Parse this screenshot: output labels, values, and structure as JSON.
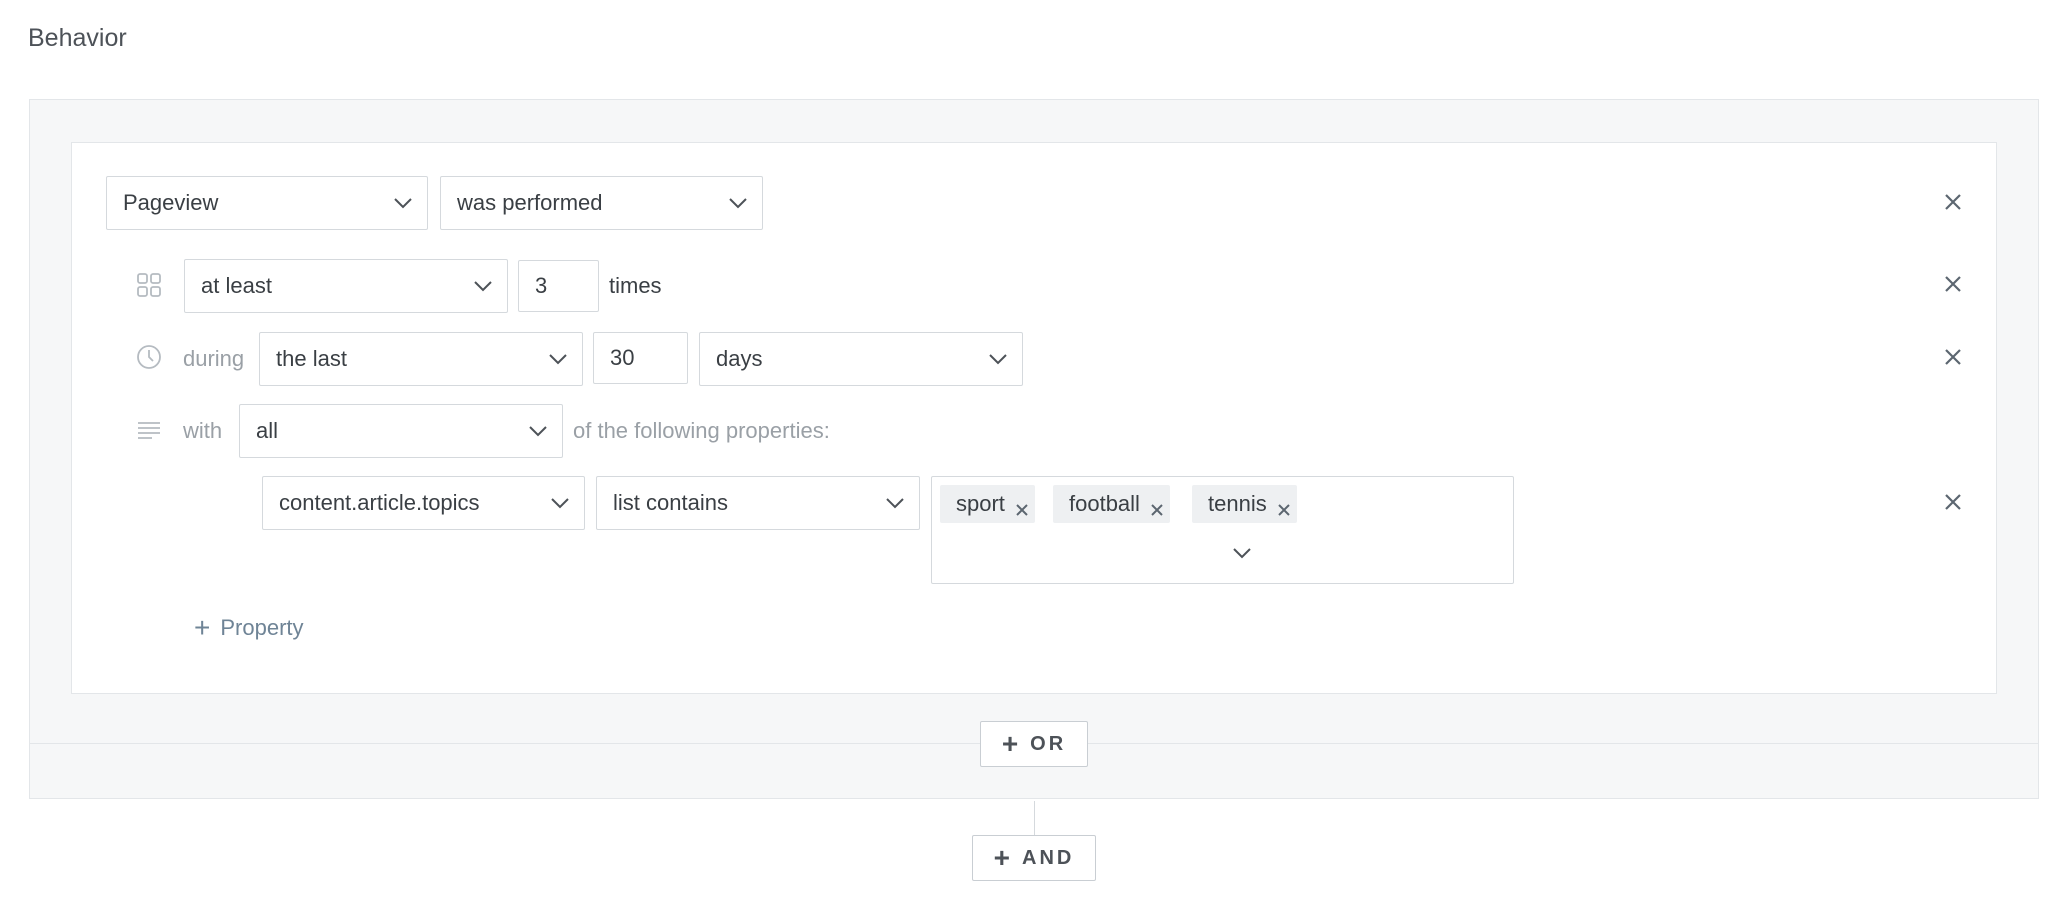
{
  "section": {
    "title": "Behavior"
  },
  "condition": {
    "event": {
      "value": "Pageview"
    },
    "operator": {
      "value": "was performed"
    },
    "frequency": {
      "icon": "grid-icon",
      "comparison": "at least",
      "count": "3",
      "unit_label": "times"
    },
    "timeframe": {
      "icon": "clock-icon",
      "prefix": "during",
      "range": "the last",
      "amount": "30",
      "unit": "days"
    },
    "properties": {
      "icon": "lines-icon",
      "prefix": "with",
      "match": "all",
      "suffix": "of the following properties:",
      "rows": [
        {
          "property": "content.article.topics",
          "operator": "list contains",
          "values": [
            "sport",
            "football",
            "tennis"
          ]
        }
      ],
      "add_label": "Property"
    }
  },
  "buttons": {
    "or_label": "OR",
    "and_label": "AND"
  },
  "colors": {
    "panel_bg": "#f6f7f8",
    "border": "#d5d9dd",
    "muted_text": "#9aa0a6",
    "link": "#6f8496"
  }
}
